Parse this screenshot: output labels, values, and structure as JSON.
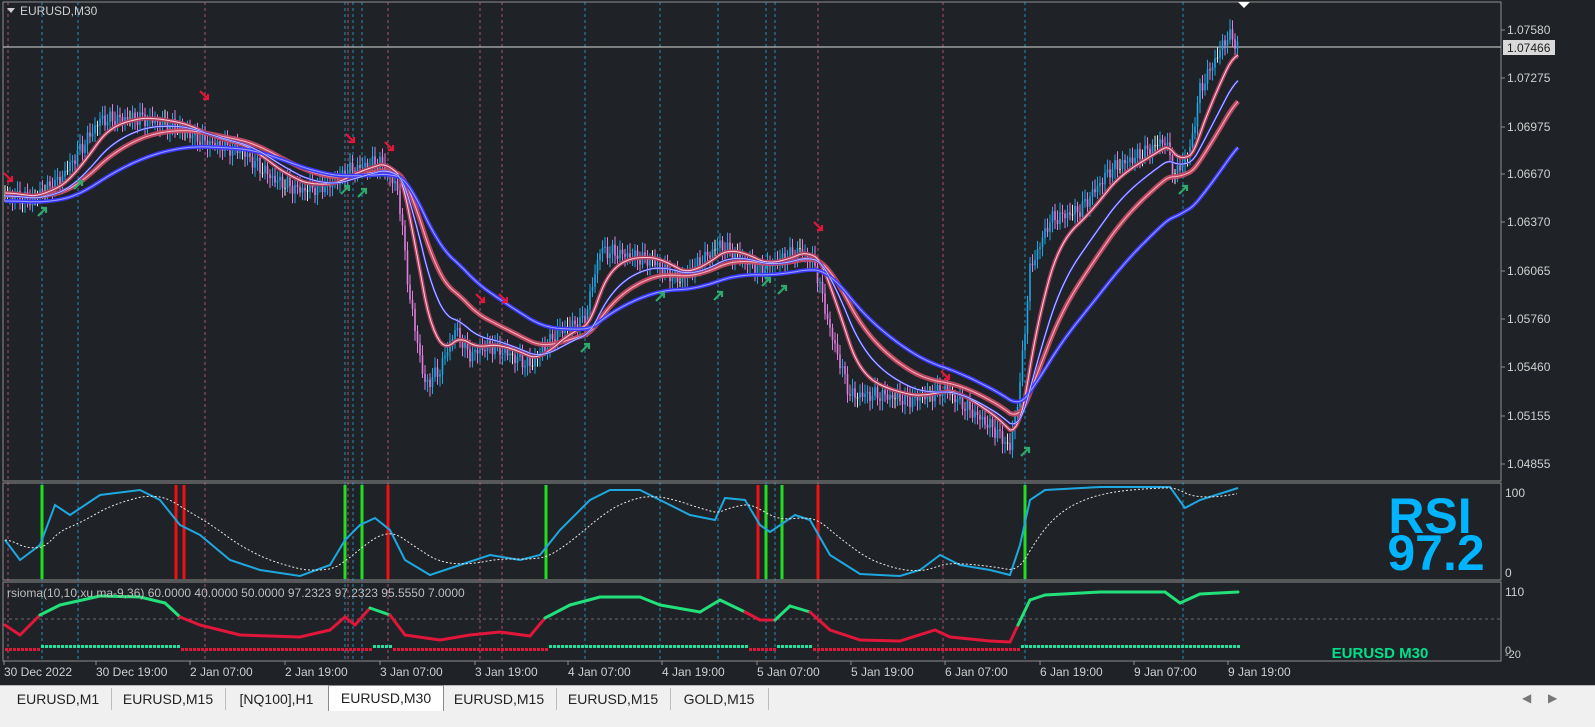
{
  "window": {
    "title": "EURUSD,M30"
  },
  "price_axis": {
    "ticks": [
      "1.07580",
      "1.07275",
      "1.06975",
      "1.06670",
      "1.06370",
      "1.06065",
      "1.05760",
      "1.05460",
      "1.05155",
      "1.04855"
    ],
    "current_price": "1.07466"
  },
  "time_axis": {
    "ticks": [
      "30 Dec 2022",
      "30 Dec 19:00",
      "2 Jan 07:00",
      "2 Jan 19:00",
      "3 Jan 07:00",
      "3 Jan 19:00",
      "4 Jan 07:00",
      "4 Jan 19:00",
      "5 Jan 07:00",
      "5 Jan 19:00",
      "6 Jan 07:00",
      "6 Jan 19:00",
      "9 Jan 07:00",
      "9 Jan 19:00"
    ]
  },
  "rsi_panel": {
    "scale_top": "100",
    "scale_bottom": "0",
    "label": "RSI",
    "value": "97.2"
  },
  "rsioma_panel": {
    "indicator_text": "rsioma(10,10,xu ma-9,36) 60.0000 40.0000 50.0000 97.2323 97.2323 95.5550 7.0000",
    "scale_top": "110",
    "scale_bottom": "-20",
    "scale_bottom2": "0",
    "symbol_label": "EURUSD M30"
  },
  "tabs": [
    {
      "label": "EURUSD,M1",
      "active": false
    },
    {
      "label": "EURUSD,M15",
      "active": false
    },
    {
      "label": "[NQ100],H1",
      "active": false
    },
    {
      "label": "EURUSD,M30",
      "active": true
    },
    {
      "label": "EURUSD,M15",
      "active": false
    },
    {
      "label": "EURUSD,M15",
      "active": false
    },
    {
      "label": "GOLD,M15",
      "active": false
    }
  ],
  "colors": {
    "background": "#1f2226",
    "bull": "#1ea7e8",
    "bear": "#e27ce0",
    "neutral": "#e8e8e8",
    "ma_fast": "#ff3b5c",
    "ma_slow": "#3a3aff",
    "signal_up": "#2ea86b",
    "signal_down": "#e0163b",
    "rsi_line": "#1fa8e0",
    "rsioma_up": "#22e07a",
    "rsioma_down": "#e0163b",
    "rsi_label": "#00b4ff",
    "symbol_label": "#00e08a"
  },
  "icons": {
    "collapse": "triangle-down-icon",
    "scroll_left": "chevron-left-icon",
    "scroll_right": "chevron-right-icon"
  }
}
